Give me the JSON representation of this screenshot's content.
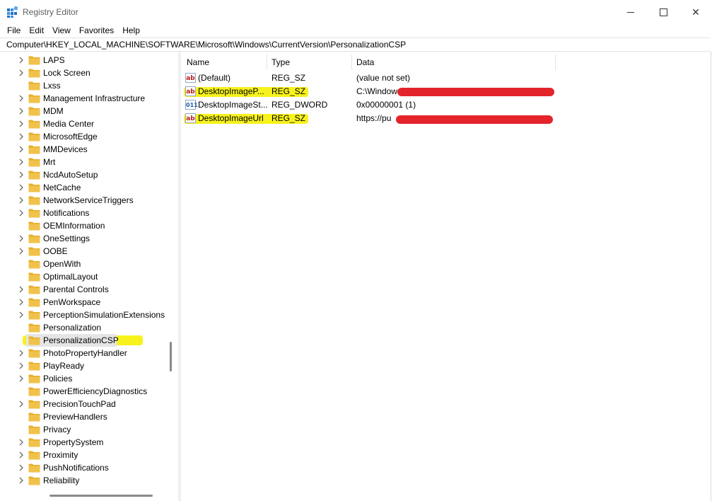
{
  "window": {
    "title": "Registry Editor",
    "controls": {
      "minimize": "",
      "maximize": "",
      "close": "✕"
    }
  },
  "menu": [
    "File",
    "Edit",
    "View",
    "Favorites",
    "Help"
  ],
  "address": "Computer\\HKEY_LOCAL_MACHINE\\SOFTWARE\\Microsoft\\Windows\\CurrentVersion\\PersonalizationCSP",
  "tree": {
    "items": [
      {
        "label": "LAPS",
        "expandable": true
      },
      {
        "label": "Lock Screen",
        "expandable": true
      },
      {
        "label": "Lxss",
        "expandable": false
      },
      {
        "label": "Management Infrastructure",
        "expandable": true
      },
      {
        "label": "MDM",
        "expandable": true
      },
      {
        "label": "Media Center",
        "expandable": true
      },
      {
        "label": "MicrosoftEdge",
        "expandable": true
      },
      {
        "label": "MMDevices",
        "expandable": true
      },
      {
        "label": "Mrt",
        "expandable": true
      },
      {
        "label": "NcdAutoSetup",
        "expandable": true
      },
      {
        "label": "NetCache",
        "expandable": true
      },
      {
        "label": "NetworkServiceTriggers",
        "expandable": true
      },
      {
        "label": "Notifications",
        "expandable": true
      },
      {
        "label": "OEMInformation",
        "expandable": false
      },
      {
        "label": "OneSettings",
        "expandable": true
      },
      {
        "label": "OOBE",
        "expandable": true
      },
      {
        "label": "OpenWith",
        "expandable": false
      },
      {
        "label": "OptimalLayout",
        "expandable": false
      },
      {
        "label": "Parental Controls",
        "expandable": true
      },
      {
        "label": "PenWorkspace",
        "expandable": true
      },
      {
        "label": "PerceptionSimulationExtensions",
        "expandable": true
      },
      {
        "label": "Personalization",
        "expandable": false
      },
      {
        "label": "PersonalizationCSP",
        "expandable": false,
        "selected": true
      },
      {
        "label": "PhotoPropertyHandler",
        "expandable": true
      },
      {
        "label": "PlayReady",
        "expandable": true
      },
      {
        "label": "Policies",
        "expandable": true
      },
      {
        "label": "PowerEfficiencyDiagnostics",
        "expandable": false
      },
      {
        "label": "PrecisionTouchPad",
        "expandable": true
      },
      {
        "label": "PreviewHandlers",
        "expandable": false
      },
      {
        "label": "Privacy",
        "expandable": false
      },
      {
        "label": "PropertySystem",
        "expandable": true
      },
      {
        "label": "Proximity",
        "expandable": true
      },
      {
        "label": "PushNotifications",
        "expandable": true
      },
      {
        "label": "Reliability",
        "expandable": true
      }
    ]
  },
  "values": {
    "columns": {
      "name": "Name",
      "type": "Type",
      "data": "Data"
    },
    "rows": [
      {
        "icon": "string-value-icon",
        "name": "(Default)",
        "type": "REG_SZ",
        "data": "(value not set)",
        "highlighted": false
      },
      {
        "icon": "string-value-icon",
        "name": "DesktopImageP...",
        "type": "REG_SZ",
        "data": "C:\\Windows\\",
        "highlighted": true,
        "redacted": true
      },
      {
        "icon": "dword-value-icon",
        "name": "DesktopImageSt...",
        "type": "REG_DWORD",
        "data": "0x00000001 (1)",
        "highlighted": false
      },
      {
        "icon": "string-value-icon",
        "name": "DesktopImageUrl",
        "type": "REG_SZ",
        "data": "https://pu",
        "highlighted": true,
        "redacted": true
      }
    ]
  },
  "colors": {
    "highlight": "#f7f21c",
    "redaction": "#e3242b",
    "folder": "#f1c24b",
    "selection": "#e5e5e5"
  }
}
